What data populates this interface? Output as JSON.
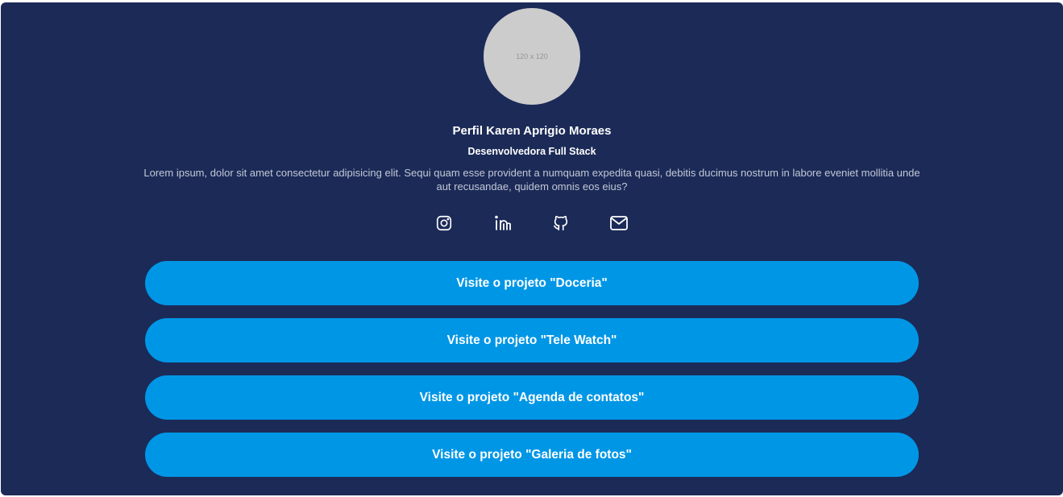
{
  "profile": {
    "avatar_placeholder": "120 x 120",
    "title": "Perfil Karen Aprigio Moraes",
    "subtitle": "Desenvolvedora Full Stack",
    "bio": "Lorem ipsum, dolor sit amet consectetur adipisicing elit. Sequi quam esse provident a numquam expedita quasi, debitis ducimus nostrum in labore eveniet mollitia unde aut recusandae, quidem omnis eos eius?"
  },
  "socials": [
    {
      "icon": "instagram-icon"
    },
    {
      "icon": "linkedin-icon"
    },
    {
      "icon": "github-icon"
    },
    {
      "icon": "mail-icon"
    }
  ],
  "projects": [
    {
      "label": "Visite o projeto \"Doceria\""
    },
    {
      "label": "Visite o projeto \"Tele Watch\""
    },
    {
      "label": "Visite o projeto \"Agenda de contatos\""
    },
    {
      "label": "Visite o projeto \"Galeria de fotos\""
    }
  ],
  "colors": {
    "background": "#1b2a57",
    "button": "#0096e6",
    "text": "#ffffff",
    "avatar": "#cccccc"
  }
}
